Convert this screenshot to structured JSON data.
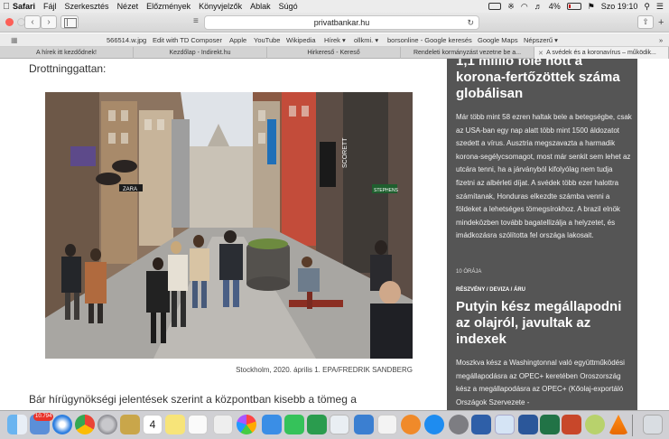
{
  "menubar": {
    "app": "Safari",
    "items": [
      "Fájl",
      "Szerkesztés",
      "Nézet",
      "Előzmények",
      "Könyvjelzők",
      "Ablak",
      "Súgó"
    ],
    "battery": "4%",
    "clock": "Szo 19:10"
  },
  "toolbar": {
    "url": "privatbankar.hu"
  },
  "bookmarks": [
    "566514.w.jpg",
    "Edit with TD Composer",
    "Apple",
    "YouTube",
    "Wikipedia",
    "Hírek ▾",
    "ollkmi. ▾",
    "borsonline - Google keresés",
    "Google Maps",
    "Népszerű ▾"
  ],
  "tabs": [
    {
      "label": "A hírek itt kezdődnek!",
      "active": false
    },
    {
      "label": "Kezdőlap - Indirekt.hu",
      "active": false
    },
    {
      "label": "Hirkereső - Kereső",
      "active": false
    },
    {
      "label": "Rendeleti kormányzást vezetne be a...",
      "active": false
    },
    {
      "label": "A svédek és a koronavírus – működik...",
      "active": true
    }
  ],
  "article": {
    "intro": "Drottninggattan:",
    "caption": "Stockholm, 2020. április 1. EPA/FREDRIK SANDBERG",
    "body": "Bár hírügynökségi jelentések szerint a központban kisebb a tömeg a"
  },
  "photo": {
    "signs": [
      "ZARA",
      "SCORETT",
      "STEPHENS"
    ]
  },
  "sidebar": {
    "headline1": "1,1 millió fölé nőtt a korona-fertőzöttek száma globálisan",
    "text1": "Már több mint 58 ezren haltak bele a betegségbe, csak az USA-ban egy nap alatt több mint 1500 áldozatot szedett a vírus. Ausztria megszavazta a harmadik korona-segélycsomagot, most már senkit sem lehet az utcára tenni, ha a járványból kifolyólag nem tudja fizetni az albérleti díjat. A svédek több ezer halottra számítanak, Honduras elkezdte számba venni a földeket a lehetséges tömegsírokhoz. A brazil elnök mindeközben tovább bagatellizálja a helyzetet, és imádkozásra szólította fel országa lakosait.",
    "time": "10 ÓRÁJA",
    "category": "RÉSZVÉNY / DEVIZA / ÁRU",
    "headline2": "Putyin kész megállapodni az olajról, javultak az indexek",
    "text2": "Moszkva kész a Washingtonnal való együttműködési megállapodásra az OPEC+ keretében Oroszország kész a megállapodásra az OPEC+ (Kőolaj-exportáló Országok Szervezete -"
  },
  "dock": {
    "badge": "10.794",
    "calendar_day": "4",
    "icons": [
      "finder-icon",
      "mail-icon",
      "safari-icon",
      "chrome-icon",
      "launchpad-icon",
      "notes-icon",
      "calendar-icon",
      "stickies-icon",
      "reminders-icon",
      "photos-icon",
      "messages-icon",
      "facetime-icon",
      "numbers-icon",
      "keynote-icon",
      "itunes-icon",
      "books-icon",
      "appstore-icon",
      "system-preferences-icon",
      "quicktime-icon",
      "word-icon",
      "excel-icon",
      "powerpoint-icon",
      "game-icon",
      "vlc-icon",
      "trash-icon"
    ]
  }
}
